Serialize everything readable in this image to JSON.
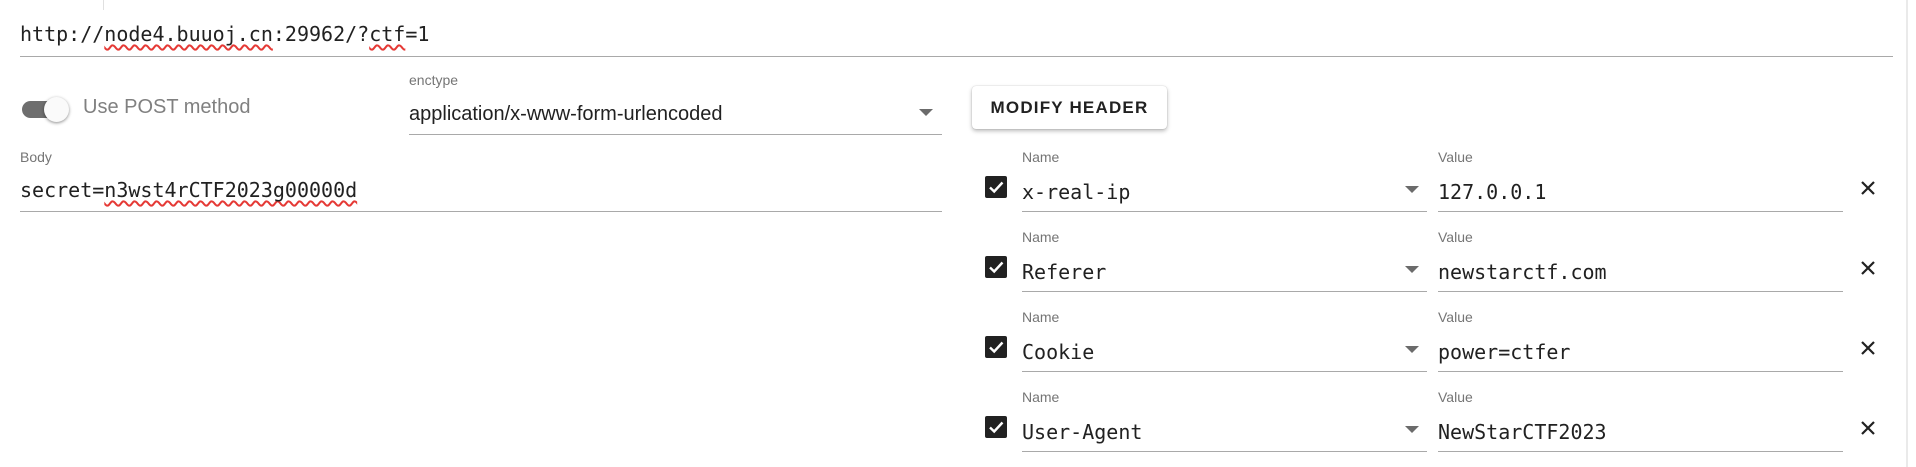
{
  "request": {
    "url_prefix": "http://",
    "url_host": "node4.buuoj.cn",
    "url_port_path": ":29962/?",
    "url_param": "ctf",
    "url_tail": "=1"
  },
  "post": {
    "label": "Use POST method",
    "enabled": true
  },
  "enctype": {
    "caption": "enctype",
    "value": "application/x-www-form-urlencoded"
  },
  "modify_header": {
    "label": "MODIFY HEADER"
  },
  "body": {
    "caption": "Body",
    "prefix": "secret=",
    "value": "n3wst4rCTF2023g00000d"
  },
  "headers": {
    "name_caption": "Name",
    "value_caption": "Value",
    "rows": [
      {
        "checked": true,
        "name": "x-real-ip",
        "value": "127.0.0.1"
      },
      {
        "checked": true,
        "name": "Referer",
        "value": "newstarctf.com"
      },
      {
        "checked": true,
        "name": "Cookie",
        "value": "power=ctfer"
      },
      {
        "checked": true,
        "name": "User-Agent",
        "value": "NewStarCTF2023"
      }
    ]
  },
  "icons": {
    "checkbox": "check-icon",
    "remove": "close-icon",
    "dropdown": "chevron-down-icon"
  },
  "colors": {
    "text": "#212121",
    "caption": "#757575",
    "toggle_track": "#6e6e6e",
    "checkbox_fill": "#212121",
    "spellcheck": "#e53935"
  }
}
